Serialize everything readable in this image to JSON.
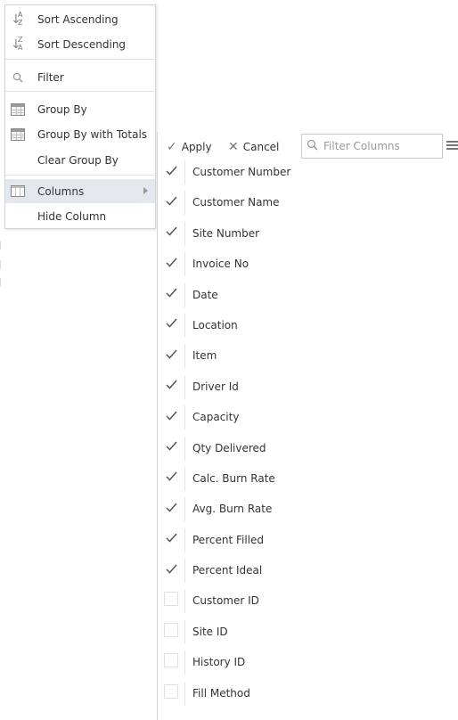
{
  "context_menu": {
    "items": [
      {
        "key": "sort_asc",
        "label": "Sort Ascending",
        "icon": "sort-ascending-icon",
        "glyph_top": "A",
        "glyph_bottom": "Z"
      },
      {
        "key": "sort_desc",
        "label": "Sort Descending",
        "icon": "sort-descending-icon",
        "glyph_top": "Z",
        "glyph_bottom": "A"
      },
      {
        "key": "filter",
        "label": "Filter",
        "icon": "search-icon"
      },
      {
        "key": "group_by",
        "label": "Group By",
        "icon": "grid-icon"
      },
      {
        "key": "group_by_totals",
        "label": "Group By with Totals",
        "icon": "grid-icon"
      },
      {
        "key": "clear_group_by",
        "label": "Clear Group By",
        "icon": ""
      },
      {
        "key": "columns",
        "label": "Columns",
        "icon": "columns-icon",
        "active": true
      },
      {
        "key": "hide_column",
        "label": "Hide Column",
        "icon": ""
      }
    ],
    "active_bg": "#e3e8ee"
  },
  "columns_panel": {
    "apply_label": "Apply",
    "cancel_label": "Cancel",
    "filter_placeholder": "Filter Columns",
    "filter_value": "",
    "columns": [
      {
        "label": "Customer Number",
        "checked": true
      },
      {
        "label": "Customer Name",
        "checked": true
      },
      {
        "label": "Site Number",
        "checked": true
      },
      {
        "label": "Invoice No",
        "checked": true
      },
      {
        "label": "Date",
        "checked": true
      },
      {
        "label": "Location",
        "checked": true
      },
      {
        "label": "Item",
        "checked": true
      },
      {
        "label": "Driver Id",
        "checked": true
      },
      {
        "label": "Capacity",
        "checked": true
      },
      {
        "label": "Qty Delivered",
        "checked": true
      },
      {
        "label": "Calc. Burn Rate",
        "checked": true
      },
      {
        "label": "Avg. Burn Rate",
        "checked": true
      },
      {
        "label": "Percent Filled",
        "checked": true
      },
      {
        "label": "Percent Ideal",
        "checked": true
      },
      {
        "label": "Customer ID",
        "checked": false
      },
      {
        "label": "Site ID",
        "checked": false
      },
      {
        "label": "History ID",
        "checked": false
      },
      {
        "label": "Fill Method",
        "checked": false
      }
    ]
  }
}
